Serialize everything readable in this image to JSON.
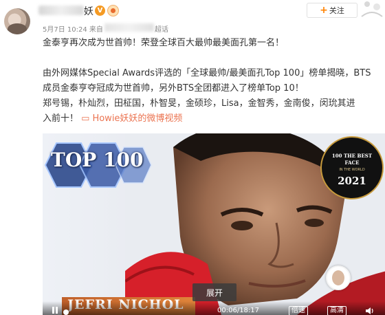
{
  "post": {
    "author_name_visible": "妖",
    "vip_badge": "V",
    "date_time": "5月7日 10:24 来自",
    "source_tail": "超话",
    "follow_label": "关注",
    "follow_plus": "+",
    "lines": [
      "金泰亨再次成为世首帅！荣登全球百大最帅最美面孔第一名！",
      "由外网媒体Special Awards评选的「全球最帅/最美面孔Top 100」榜单揭晓，BTS",
      "成员金泰亨夺冠成为世首帅，另外BTS全团都进入了榜单Top 10！",
      "郑号锡，朴灿烈，田柾国，朴智旻，金硕珍，Lisa，金智秀，金南俊，闵玧其进",
      "入前十！"
    ],
    "video_link_icon": "▭",
    "video_link_text": "Howie妖妖的微博视频"
  },
  "video": {
    "banner_text": "TOP 100",
    "seal_line1": "100 THE BEST",
    "seal_line2": "FACE",
    "seal_line3": "IN THE WORLD",
    "seal_year": "2021",
    "expand_label": "展开",
    "name_plate": "JEFRI NICHOL",
    "time_code": "00:06/18:17",
    "rate_label": "倍速",
    "hd_label": "高清"
  },
  "colors": {
    "accent": "#eb7350",
    "follow_plus": "#ff8200",
    "vip": "#f59a23"
  },
  "icons": [
    "avatar",
    "vip-badge-icon",
    "level-icon",
    "plus-icon",
    "video-link-icon",
    "play-pause-icon",
    "volume-icon"
  ]
}
